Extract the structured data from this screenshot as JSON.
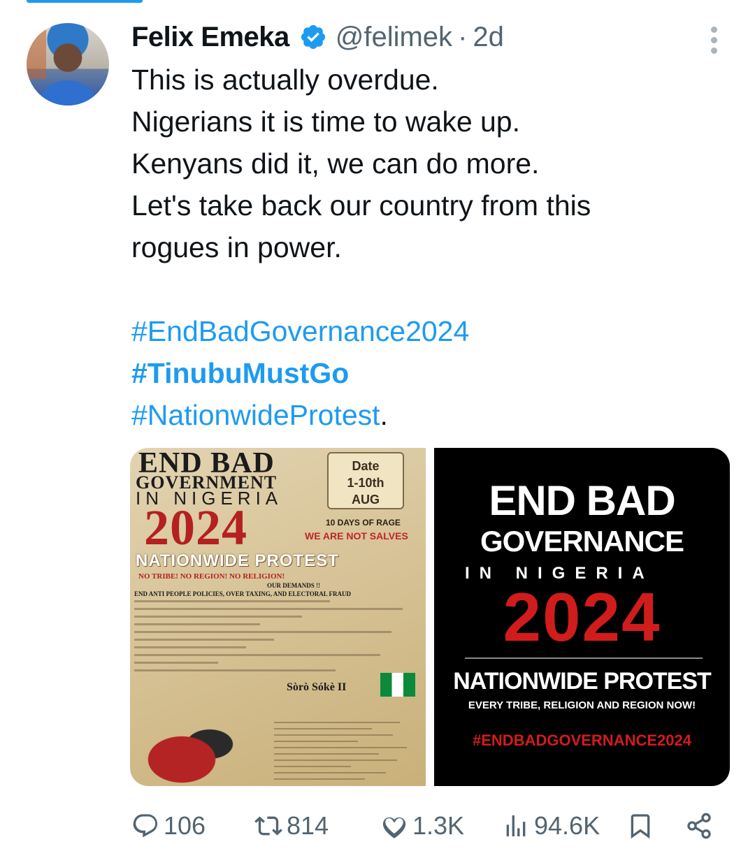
{
  "tweet": {
    "author_name": "Felix Emeka",
    "handle": "@felimek",
    "separator": "·",
    "time": "2d",
    "body_lines": [
      "This is actually overdue.",
      "Nigerians it is time to wake up.",
      "Kenyans did it, we can do more.",
      "Let's take back our country from this",
      "rogues in power."
    ],
    "hashtags": [
      "#EndBadGovernance2024",
      "#TinubuMustGo",
      "#NationwideProtest"
    ],
    "trailing_period": "."
  },
  "media": {
    "left_poster": {
      "title": "END BAD",
      "sub1": "GOVERNMENT",
      "sub2": "IN NIGERIA",
      "year": "2024",
      "date_label": "Date",
      "date_range": "1-10th",
      "date_month": "AUG",
      "rage": "10 DAYS OF RAGE",
      "salves": "WE ARE NOT SALVES",
      "nationwide": "NATIONWIDE PROTEST",
      "tribe": "NO TRIBE! NO REGION! NO RELIGION!",
      "demands": "OUR DEMANDS !!",
      "anti": "END ANTI PEOPLE POLICIES, OVER TAXING, AND ELECTORAL FRAUD",
      "soro": "Sòrò Sókè II"
    },
    "right_poster": {
      "end_bad": "END BAD",
      "governance": "GOVERNANCE",
      "in_nigeria": "IN NIGERIA",
      "year": "2024",
      "nationwide": "NATIONWIDE PROTEST",
      "every": "EVERY TRIBE, RELIGION AND REGION NOW!",
      "hashtag": "#ENDBADGOVERNANCE2024"
    }
  },
  "actions": {
    "replies": "106",
    "reposts": "814",
    "likes": "1.3K",
    "views": "94.6K"
  },
  "icons": [
    "verified-badge-icon",
    "more-options-icon",
    "reply-icon",
    "repost-icon",
    "like-icon",
    "views-icon",
    "bookmark-icon",
    "share-icon"
  ],
  "colors": {
    "accent": "#1d9bf0",
    "muted": "#536471",
    "text": "#0f1419",
    "poster_red": "#d11c1c"
  }
}
